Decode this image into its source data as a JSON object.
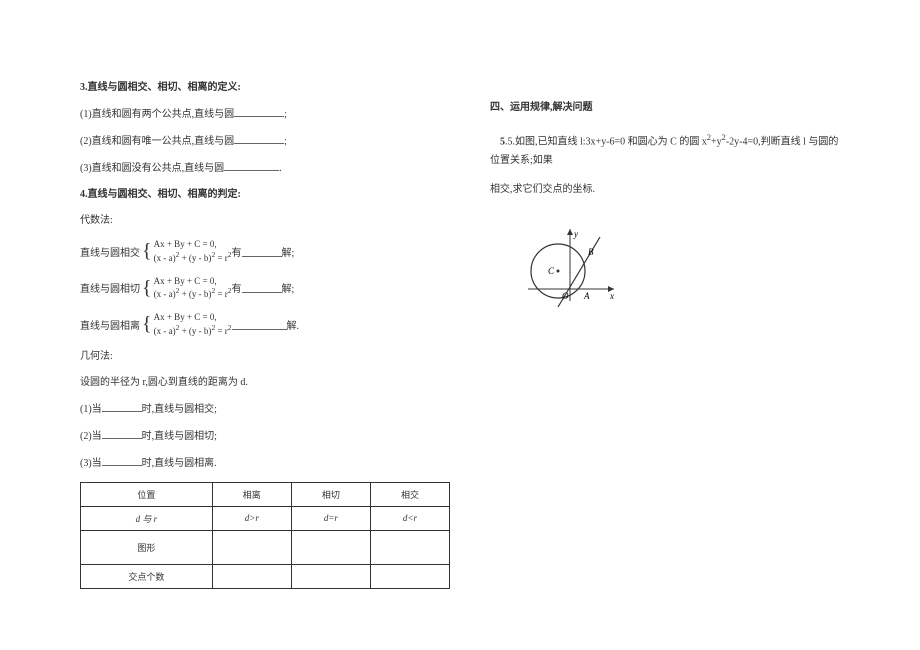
{
  "left": {
    "q3_title": "3.直线与圆相交、相切、相离的定义:",
    "q3_1": "(1)直线和圆有两个公共点,直线与圆",
    "q3_2": "(2)直线和圆有唯一公共点,直线与圆",
    "q3_3": "(3)直线和圆没有公共点,直线与圆",
    "semicolon": ";",
    "period": ".",
    "q4_title": "4.直线与圆相交、相切、相离的判定:",
    "algebraic_label": "代数法:",
    "eq1": "Ax + By + C = 0,",
    "eq2_lhs": "(x - a)",
    "eq2_sup": "2",
    "eq2_plus": " + (y - b)",
    "eq2_eq": " = r",
    "alg_intersect_prefix": "直线与圆相交",
    "alg_tangent_prefix": "直线与圆相切",
    "alg_separate_prefix": "直线与圆相离",
    "you": "有",
    "jie": "解;",
    "jie_period": "解.",
    "geometric_label": "几何法:",
    "geo_setup": "设圆的半径为 r,圆心到直线的距离为 d.",
    "geo_1_prefix": "(1)当",
    "geo_1_suffix": "时,直线与圆相交;",
    "geo_2_prefix": "(2)当",
    "geo_2_suffix": "时,直线与圆相切;",
    "geo_3_prefix": "(3)当",
    "geo_3_suffix": "时,直线与圆相离.",
    "table": {
      "h_pos": "位置",
      "h_sep": "相离",
      "h_tan": "相切",
      "h_int": "相交",
      "row_d_r": "d 与 r",
      "c_sep": "d>r",
      "c_tan": "d=r",
      "c_int": "d<r",
      "row_shape": "图形",
      "row_count": "交点个数"
    }
  },
  "right": {
    "section_title": "四、运用规律,解决问题",
    "q5_prefix": "5.如图,已知直线 l:3x+y-6=0 和圆心为 C 的圆 x",
    "q5_mid1": "+y",
    "q5_mid2": "-2y-4=0,判断直线 l 与圆的位置关系;如果",
    "q5_line2": "相交,求它们交点的坐标.",
    "sup2": "2",
    "diagram": {
      "y_label": "y",
      "x_label": "x",
      "o_label": "O",
      "c_label": "C",
      "a_label": "A",
      "b_label": "B"
    }
  }
}
